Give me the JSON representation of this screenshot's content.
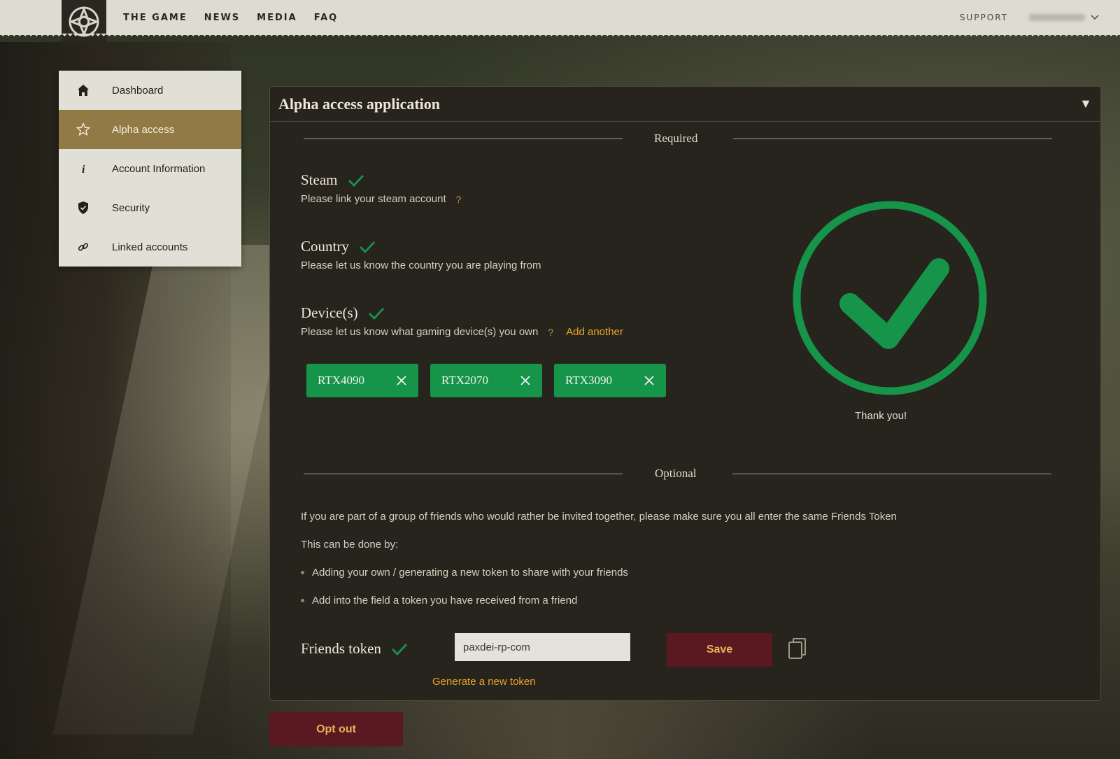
{
  "nav": {
    "links": [
      "THE GAME",
      "NEWS",
      "MEDIA",
      "FAQ"
    ],
    "support": "SUPPORT"
  },
  "sidebar": {
    "items": [
      {
        "label": "Dashboard",
        "icon": "home-icon"
      },
      {
        "label": "Alpha access",
        "icon": "star-icon",
        "active": true
      },
      {
        "label": "Account Information",
        "icon": "info-icon"
      },
      {
        "label": "Security",
        "icon": "shield-icon"
      },
      {
        "label": "Linked accounts",
        "icon": "link-icon"
      }
    ]
  },
  "panel": {
    "title": "Alpha access application",
    "required_label": "Required",
    "optional_label": "Optional",
    "steam": {
      "title": "Steam",
      "desc": "Please link your steam account",
      "help": "?"
    },
    "country": {
      "title": "Country",
      "desc": "Please let us know the country you are playing from"
    },
    "devices": {
      "title": "Device(s)",
      "desc": "Please let us know what gaming device(s) you own",
      "help": "?",
      "add_another": "Add another",
      "chips": [
        "RTX4090",
        "RTX2070",
        "RTX3090"
      ]
    },
    "thank_you": "Thank you!",
    "optional_intro": "If you are part of a group of friends who would rather be invited together, please make sure you all enter the same Friends Token",
    "optional_done_by": "This can be done by:",
    "bullets": [
      "Adding your own / generating a new token to share with your friends",
      "Add into the field a token you have received from a friend"
    ],
    "friends_token": {
      "title": "Friends token",
      "value": "paxdei-rp-com",
      "save_label": "Save",
      "generate_label": "Generate a new token"
    }
  },
  "optout_label": "Opt out",
  "colors": {
    "accent_gold": "#927a47",
    "success_green": "#15944a",
    "danger_maroon": "#5a1920",
    "link_orange": "#e8a527",
    "panel_bg": "#27231d"
  }
}
